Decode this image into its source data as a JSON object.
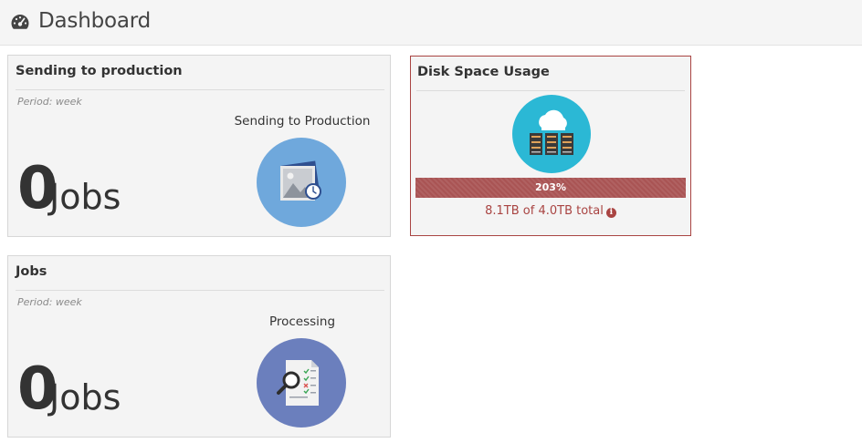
{
  "header": {
    "title": "Dashboard",
    "icon": "dashboard-gauge-icon"
  },
  "cards": [
    {
      "title": "Sending to production",
      "period": "Period: week",
      "metric_label": "Sending to Production",
      "count": "0",
      "unit": "Jobs",
      "icon": "image-clock-icon",
      "icon_color": "#6fa8dc"
    },
    {
      "title": "Jobs",
      "period": "Period: week",
      "metric_label": "Processing",
      "count": "0",
      "unit": "Jobs",
      "icon": "document-search-icon",
      "icon_color": "#6b7fbd"
    }
  ],
  "disk": {
    "title": "Disk Space Usage",
    "icon": "cloud-server-icon",
    "percent_label": "203%",
    "percent": 203,
    "usage_text": "8.1TB of 4.0TB total",
    "bar_color": "#a95454",
    "text_color": "#a94442"
  }
}
